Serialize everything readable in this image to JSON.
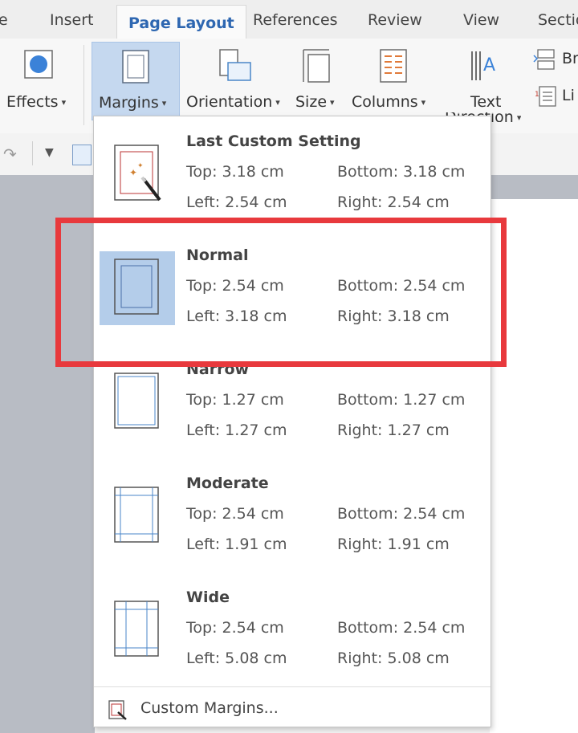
{
  "tabs": [
    {
      "label": "e"
    },
    {
      "label": "Insert"
    },
    {
      "label": "Page Layout"
    },
    {
      "label": "References"
    },
    {
      "label": "Review"
    },
    {
      "label": "View"
    },
    {
      "label": "Sectio"
    }
  ],
  "ribbon": {
    "effects": "Effects",
    "margins": "Margins",
    "orientation": "Orientation",
    "size": "Size",
    "columns": "Columns",
    "text_direction_line1": "Text",
    "text_direction_line2": "Direction",
    "breaks_partial": "Br",
    "line_numbers_partial": "Li"
  },
  "colors": {
    "accent_tab": "#2e67b1",
    "selected": "#b4cdea",
    "highlight": "#e8393d"
  },
  "margins_menu": {
    "options": [
      {
        "name": "Last Custom Setting",
        "top": "Top: 3.18 cm",
        "bottom": "Bottom: 3.18 cm",
        "left": "Left: 2.54 cm",
        "right": "Right: 2.54 cm"
      },
      {
        "name": "Normal",
        "top": "Top: 2.54 cm",
        "bottom": "Bottom: 2.54 cm",
        "left": "Left: 3.18 cm",
        "right": "Right: 3.18 cm",
        "selected": true
      },
      {
        "name": "Narrow",
        "top": "Top: 1.27 cm",
        "bottom": "Bottom: 1.27 cm",
        "left": "Left: 1.27 cm",
        "right": "Right: 1.27 cm"
      },
      {
        "name": "Moderate",
        "top": "Top: 2.54 cm",
        "bottom": "Bottom: 2.54 cm",
        "left": "Left: 1.91 cm",
        "right": "Right: 1.91 cm"
      },
      {
        "name": "Wide",
        "top": "Top: 2.54 cm",
        "bottom": "Bottom: 2.54 cm",
        "left": "Left: 5.08 cm",
        "right": "Right: 5.08 cm"
      }
    ],
    "custom_margins": "Custom Margins..."
  }
}
